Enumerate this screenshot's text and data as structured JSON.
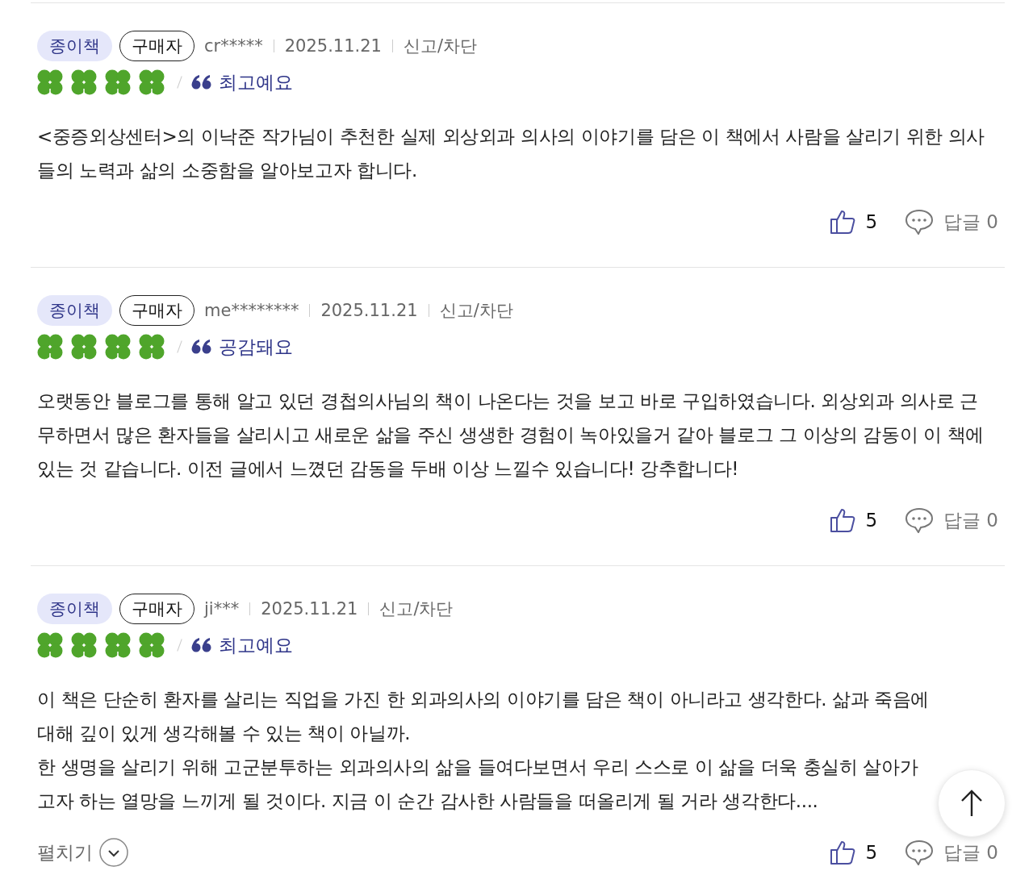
{
  "reviews": [
    {
      "format": "종이책",
      "buyer": "구매자",
      "user": "cr*****",
      "date": "2025.11.21",
      "report": "신고/차단",
      "stars": 4,
      "tag": "최고예요",
      "paragraphs": [
        "<중증외상센터>의 이낙준 작가님이 추천한 실제 외상외과 의사의 이야기를 담은 이 책에서 사람을 살리기 위한 의사들의 노력과 삶의 소중함을 알아보고자 합니다."
      ],
      "likes": "5",
      "replies": "답글 0"
    },
    {
      "format": "종이책",
      "buyer": "구매자",
      "user": "me********",
      "date": "2025.11.21",
      "report": "신고/차단",
      "stars": 4,
      "tag": "공감돼요",
      "paragraphs": [
        "오랫동안 블로그를 통해 알고 있던 경첩의사님의 책이 나온다는 것을 보고 바로 구입하였습니다. 외상외과 의사로 근무하면서 많은 환자들을 살리시고 새로운 삶을 주신 생생한 경험이 녹아있을거 같아 블로그 그 이상의 감동이 이 책에 있는 것 같습니다. 이전 글에서 느꼈던 감동을 두배 이상 느낄수 있습니다! 강추합니다!"
      ],
      "likes": "5",
      "replies": "답글 0"
    },
    {
      "format": "종이책",
      "buyer": "구매자",
      "user": "ji***",
      "date": "2025.11.21",
      "report": "신고/차단",
      "stars": 4,
      "tag": "최고예요",
      "paragraphs": [
        "이 책은 단순히 환자를 살리는 직업을 가진 한 외과의사의 이야기를 담은 책이 아니라고 생각한다. 삶과 죽음에 대해 깊이 있게 생각해볼 수 있는 책이 아닐까.",
        "한 생명을 살리기 위해 고군분투하는 외과의사의 삶을 들여다보면서 우리 스스로 이 삶을 더욱 충실히 살아가고자 하는 열망을 느끼게 될 것이다. 지금 이 순간 감사한 사람들을 떠올리게 될 거라 생각한다...."
      ],
      "expand": "펼치기",
      "likes": "5",
      "replies": "답글 0"
    }
  ]
}
